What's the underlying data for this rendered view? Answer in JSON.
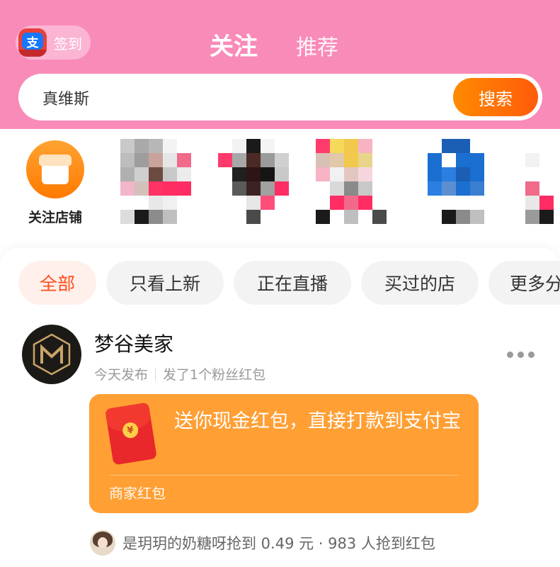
{
  "header": {
    "signin_label": "签到",
    "signin_icon_glyph": "支",
    "tabs": [
      {
        "label": "关注",
        "active": true
      },
      {
        "label": "推荐",
        "active": false
      }
    ]
  },
  "search": {
    "value": "真维斯",
    "button_label": "搜索"
  },
  "shops_row": {
    "follow_shops_label": "关注店铺",
    "follow_shops_icon": "storefront-icon"
  },
  "filters": [
    {
      "label": "全部",
      "active": true
    },
    {
      "label": "只看上新",
      "active": false
    },
    {
      "label": "正在直播",
      "active": false
    },
    {
      "label": "买过的店",
      "active": false
    },
    {
      "label": "更多分",
      "active": false
    }
  ],
  "post": {
    "shop_name": "梦谷美家",
    "publish_time": "今天发布",
    "action": "发了1个粉丝红包",
    "red_packet": {
      "title": "送你现金红包，直接打款到支付宝",
      "footer": "商家红包",
      "coin_glyph": "¥"
    },
    "grab_info": "是玥玥的奶糖呀抢到 0.49 元 · 983 人抢到红包"
  },
  "colors": {
    "header_pink": "#f98bb9",
    "accent_orange": "#ff7a00",
    "red_packet_card": "#ff9f34",
    "filter_active_text": "#ff4d1a"
  }
}
